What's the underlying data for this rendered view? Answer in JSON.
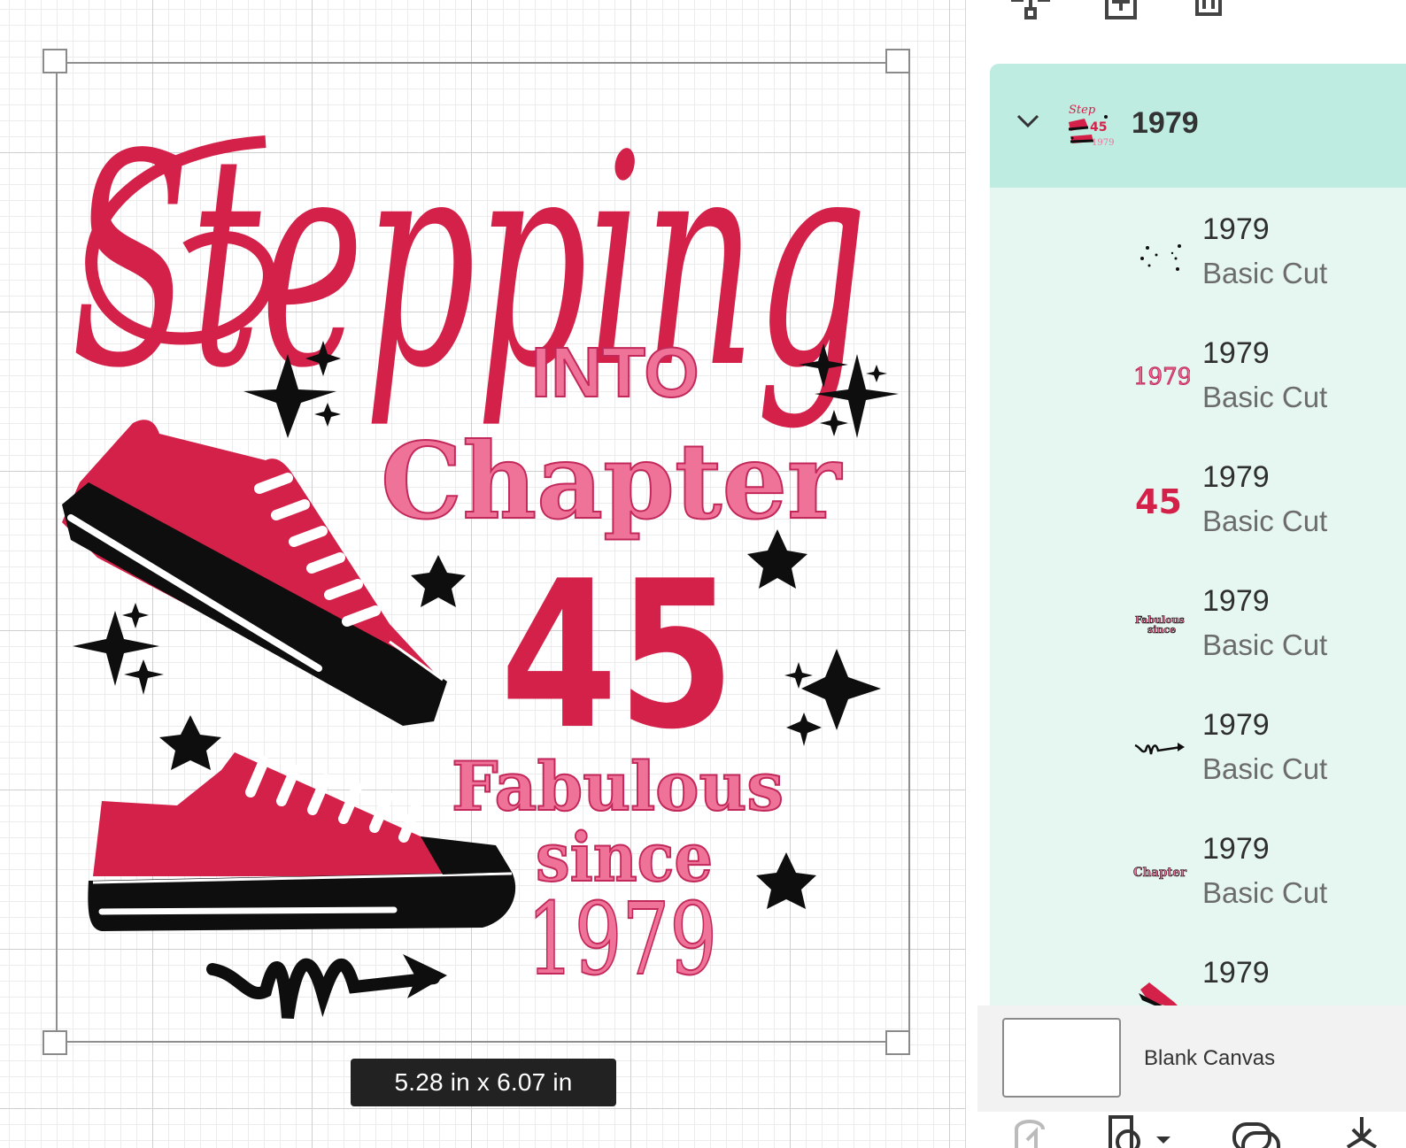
{
  "canvas": {
    "size_label": "5.28  in x 6.07  in",
    "artwork": {
      "title_script": "Stepping",
      "into": "INTO",
      "chapter": "Chapter",
      "number": "45",
      "fabulous": "Fabulous",
      "since": "since",
      "year": "1979"
    },
    "colors": {
      "crimson": "#d42149",
      "pink": "#ef7298",
      "black": "#0e0e0e"
    }
  },
  "toolbar": {
    "icons": [
      "group-icon",
      "duplicate-icon",
      "delete-icon"
    ]
  },
  "layers": {
    "group": {
      "name": "1979",
      "expanded": true
    },
    "items": [
      {
        "name": "1979",
        "type": "Basic Cut",
        "thumb": "dots"
      },
      {
        "name": "1979",
        "type": "Basic Cut",
        "thumb": "1979"
      },
      {
        "name": "1979",
        "type": "Basic Cut",
        "thumb": "45"
      },
      {
        "name": "1979",
        "type": "Basic Cut",
        "thumb": "Fabulous since"
      },
      {
        "name": "1979",
        "type": "Basic Cut",
        "thumb": "squiggle"
      },
      {
        "name": "1979",
        "type": "Basic Cut",
        "thumb": "Chapter"
      },
      {
        "name": "1979",
        "type": "",
        "thumb": "shoe"
      }
    ]
  },
  "blank_canvas": {
    "label": "Blank Canvas"
  },
  "accent": {
    "selected_row": "#bfece0",
    "list_bg": "#e6f7f1"
  }
}
